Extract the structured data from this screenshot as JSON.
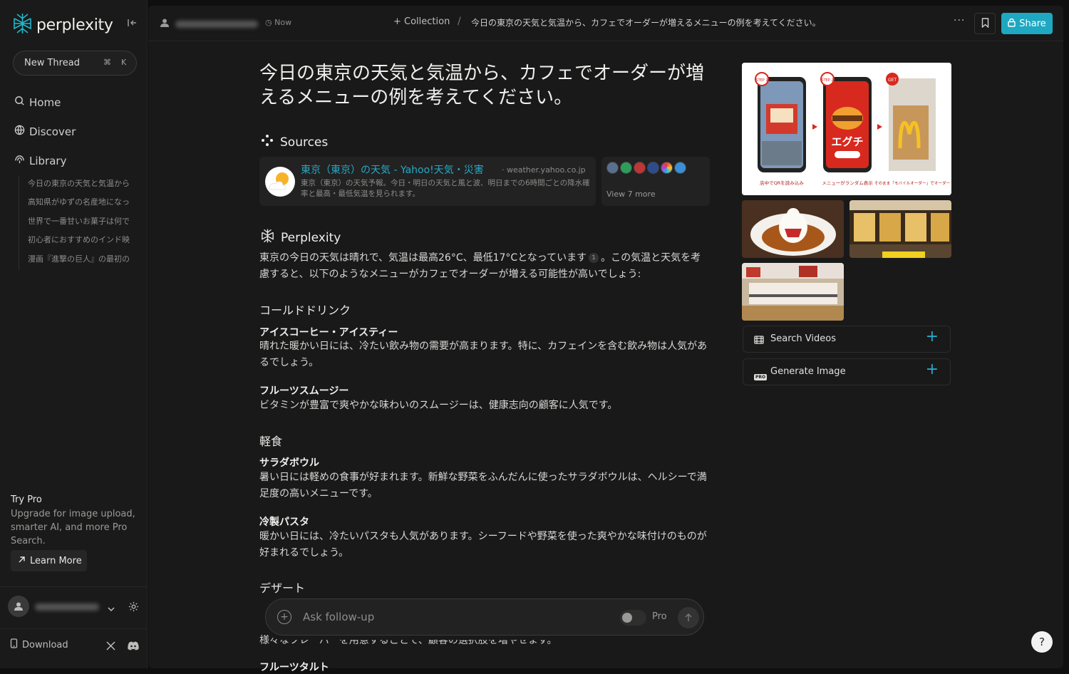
{
  "sidebar": {
    "logo_text": "perplexity",
    "new_thread": "New Thread",
    "shortcut_cmd": "⌘",
    "shortcut_key": "K",
    "nav": {
      "home": "Home",
      "discover": "Discover",
      "library": "Library"
    },
    "library_items": [
      "今日の東京の天気と気温から",
      "高知県がゆずの名産地になっ",
      "世界で一番甘いお菓子は何で",
      "初心者におすすめのインド映",
      "漫画『進撃の巨人』の最初の"
    ],
    "try_pro": {
      "title": "Try Pro",
      "description": "Upgrade for image upload, smarter AI, and more Pro Search.",
      "learn_more": "Learn More"
    },
    "download": "Download"
  },
  "topbar": {
    "time": "Now",
    "collection": "+ Collection",
    "separator": "/",
    "title": "今日の東京の天気と気温から、カフェでオーダーが増えるメニューの例を考えてください。",
    "more": "···",
    "share": "Share"
  },
  "thread": {
    "question": "今日の東京の天気と気温から、カフェでオーダーが増えるメニューの例を考えてください。",
    "sources_heading": "Sources",
    "source": {
      "title": "東京（東京）の天気 - Yahoo!天気・災害",
      "domain": "· weather.yahoo.co.jp",
      "description": "東京（東京）の天気予報。今日・明日の天気と風と波、明日までの6時間ごとの降水確率と最高・最低気温を見られます。"
    },
    "view_more": "View 7 more",
    "answer_heading": "Perplexity",
    "intro_a": "東京の今日の天気は晴れで、気温は最高26°C、最低17°Cとなっています",
    "citation": "1",
    "intro_b": "。この気温と天気を考慮すると、以下のようなメニューがカフェでオーダーが増える可能性が高いでしょう:",
    "sections": [
      {
        "heading": "コールドドリンク",
        "items": [
          {
            "title": "アイスコーヒー・アイスティー",
            "text": "晴れた暖かい日には、冷たい飲み物の需要が高まります。特に、カフェインを含む飲み物は人気があるでしょう。"
          },
          {
            "title": "フルーツスムージー",
            "text": "ビタミンが豊富で爽やかな味わいのスムージーは、健康志向の顧客に人気です。"
          }
        ]
      },
      {
        "heading": "軽食",
        "items": [
          {
            "title": "サラダボウル",
            "text": "暑い日には軽めの食事が好まれます。新鮮な野菜をふんだんに使ったサラダボウルは、ヘルシーで満足度の高いメニューです。"
          },
          {
            "title": "冷製パスタ",
            "text": "暖かい日には、冷たいパスタも人気があります。シーフードや野菜を使った爽やかな味付けのものが好まれるでしょう。"
          }
        ]
      },
      {
        "heading": "デザート"
      }
    ],
    "partial_line": "様々なフレーバーを用意することで、顧客の選択肢を増やせます。",
    "partial_heading": "フルーツタルト"
  },
  "followup": {
    "placeholder": "Ask follow-up",
    "pro_label": "Pro"
  },
  "right_panel": {
    "image_captions": [
      "店中でQRを読み込み",
      "メニューがランダム表示",
      "そのまま「モバイルオーダー」でオーダー"
    ],
    "image_badges": [
      "STEP 1",
      "STEP 2",
      "GET"
    ],
    "burger_text": "エグチ",
    "search_videos": "Search Videos",
    "generate_image": "Generate Image",
    "pro_badge": "PRO"
  },
  "help": "?",
  "colors": {
    "accent": "#1fa8c1",
    "link": "#27a9c8",
    "background": "#191919",
    "sidebar": "#1a1a1a"
  }
}
